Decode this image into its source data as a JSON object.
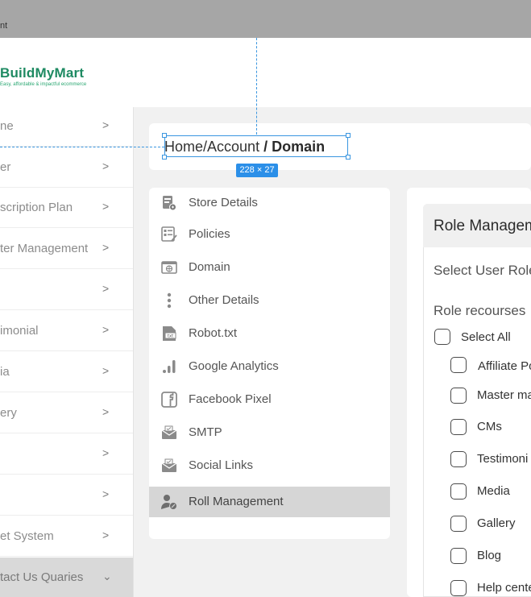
{
  "topbar": {
    "text": "nt"
  },
  "brand": {
    "name": "BuildMyMart",
    "tagline": "Easy, affordable & impactful ecommerce"
  },
  "sidebar": {
    "items": [
      {
        "label": "ne",
        "chevron": ">"
      },
      {
        "label": "er",
        "chevron": ">"
      },
      {
        "label": "scription Plan",
        "chevron": ">"
      },
      {
        "label": "ter Management",
        "chevron": ">"
      },
      {
        "label": "",
        "chevron": ">"
      },
      {
        "label": "imonial",
        "chevron": ">"
      },
      {
        "label": "ia",
        "chevron": ">"
      },
      {
        "label": "ery",
        "chevron": ">"
      },
      {
        "label": "",
        "chevron": ">"
      },
      {
        "label": "",
        "chevron": ">"
      },
      {
        "label": "et System",
        "chevron": ">"
      },
      {
        "label": "tact Us Quaries",
        "chevron": "⌄"
      }
    ]
  },
  "breadcrumb": {
    "home": "Home",
    "sep1": "/",
    "account": "Account",
    "current": " / Domain"
  },
  "selection": {
    "dimensions": "228 × 27"
  },
  "menu": {
    "items": [
      {
        "label": "Store Details",
        "icon": "store-icon"
      },
      {
        "label": "Policies",
        "icon": "policy-icon"
      },
      {
        "label": "Domain",
        "icon": "domain-icon"
      },
      {
        "label": "Other Details",
        "icon": "more-vertical-icon"
      },
      {
        "label": "Robot.txt",
        "icon": "txt-file-icon"
      },
      {
        "label": "Google Analytics",
        "icon": "analytics-icon"
      },
      {
        "label": "Facebook Pixel",
        "icon": "facebook-icon"
      },
      {
        "label": "SMTP",
        "icon": "mail-icon"
      },
      {
        "label": "Social Links",
        "icon": "social-mail-icon"
      },
      {
        "label": "Roll Management",
        "icon": "user-settings-icon"
      }
    ]
  },
  "role": {
    "title": "Role Managem",
    "select_user_role": "Select User Role",
    "resources_label": "Role recourses",
    "select_all": "Select All",
    "resources": [
      "Affiliate Po",
      "Master ma",
      "CMs",
      "Testimoni",
      "Media",
      "Gallery",
      "Blog",
      "Help cente"
    ]
  }
}
